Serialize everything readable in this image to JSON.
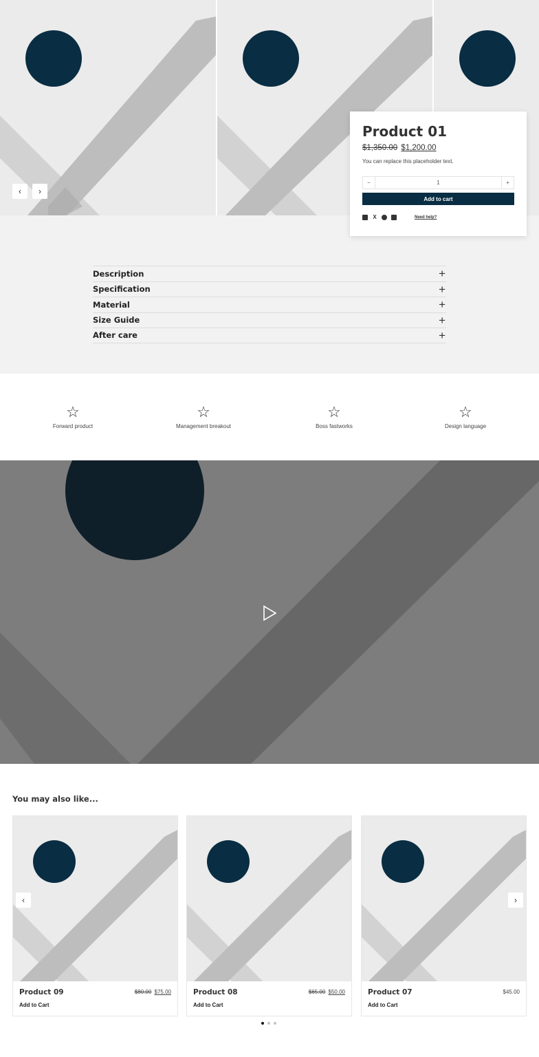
{
  "gallery": {
    "prev_arrow": "‹",
    "next_arrow": "›",
    "placeholder_colors": {
      "bg": "#ebebeb",
      "circle": "#092d42",
      "band": "#bdbdbd"
    }
  },
  "product": {
    "title": "Product 01",
    "price_old": "$1,350.00",
    "price_new": "$1,200.00",
    "description": "You can replace this placeholder text.",
    "quantity": "1",
    "qty_minus": "−",
    "qty_plus": "+",
    "add_to_cart": "Add to cart",
    "share_icons": [
      "facebook-icon",
      "x-icon",
      "whatsapp-icon",
      "email-icon"
    ],
    "need_help": "Need help?",
    "accent_color": "#092d42"
  },
  "accordion": {
    "items": [
      {
        "label": "Description"
      },
      {
        "label": "Specification"
      },
      {
        "label": "Material"
      },
      {
        "label": "Size Guide"
      },
      {
        "label": "After care"
      }
    ],
    "icon": "+"
  },
  "features": {
    "items": [
      {
        "label": "Forward product",
        "icon": "star-icon"
      },
      {
        "label": "Management breakout",
        "icon": "star-icon"
      },
      {
        "label": "Boss fastworks",
        "icon": "star-icon"
      },
      {
        "label": "Design language",
        "icon": "star-icon"
      }
    ]
  },
  "video": {
    "icon": "play-icon"
  },
  "related": {
    "title": "You may also like...",
    "cards": [
      {
        "name": "Product 09",
        "price_old": "$80.00",
        "price_new": "$75.00",
        "add": "Add to Cart"
      },
      {
        "name": "Product 08",
        "price_old": "$65.00",
        "price_new": "$50.00",
        "add": "Add to Cart"
      },
      {
        "name": "Product 07",
        "price_old": "",
        "price_new": "$45.00",
        "add": "Add to Cart"
      }
    ],
    "prev_arrow": "‹",
    "next_arrow": "›",
    "dots_total": 3,
    "dots_active": 1
  }
}
